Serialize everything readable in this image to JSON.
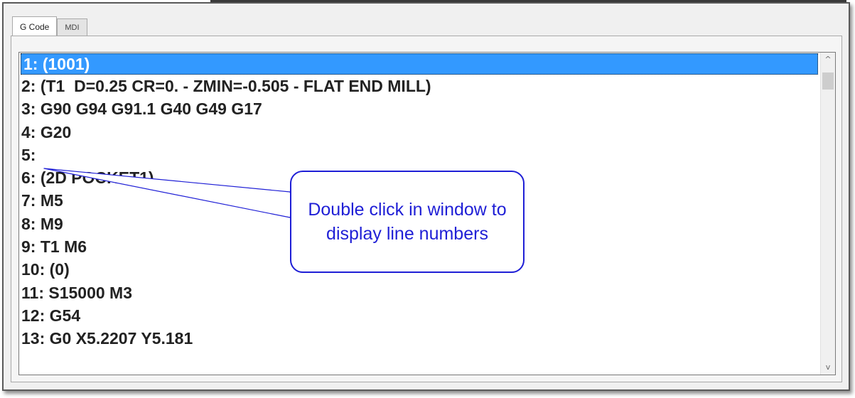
{
  "tabs": [
    {
      "label": "G Code",
      "active": true
    },
    {
      "label": "MDI",
      "active": false
    }
  ],
  "code_list": {
    "lines": [
      "1: (1001)",
      "2: (T1  D=0.25 CR=0. - ZMIN=-0.505 - FLAT END MILL)",
      "3: G90 G94 G91.1 G40 G49 G17",
      "4: G20",
      "5:",
      "6: (2D POCKET1)",
      "7: M5",
      "8: M9",
      "9: T1 M6",
      "10: (0)",
      "11: S15000 M3",
      "12: G54",
      "13: G0 X5.2207 Y5.181"
    ],
    "selected_index": 0
  },
  "scrollbar": {
    "up_glyph": "^",
    "down_glyph": "v"
  },
  "callout": {
    "text": "Double click in window to display line numbers",
    "color": "#1f1fd6"
  },
  "colors": {
    "selection": "#3399ff",
    "callout_border": "#1f1fd6"
  }
}
